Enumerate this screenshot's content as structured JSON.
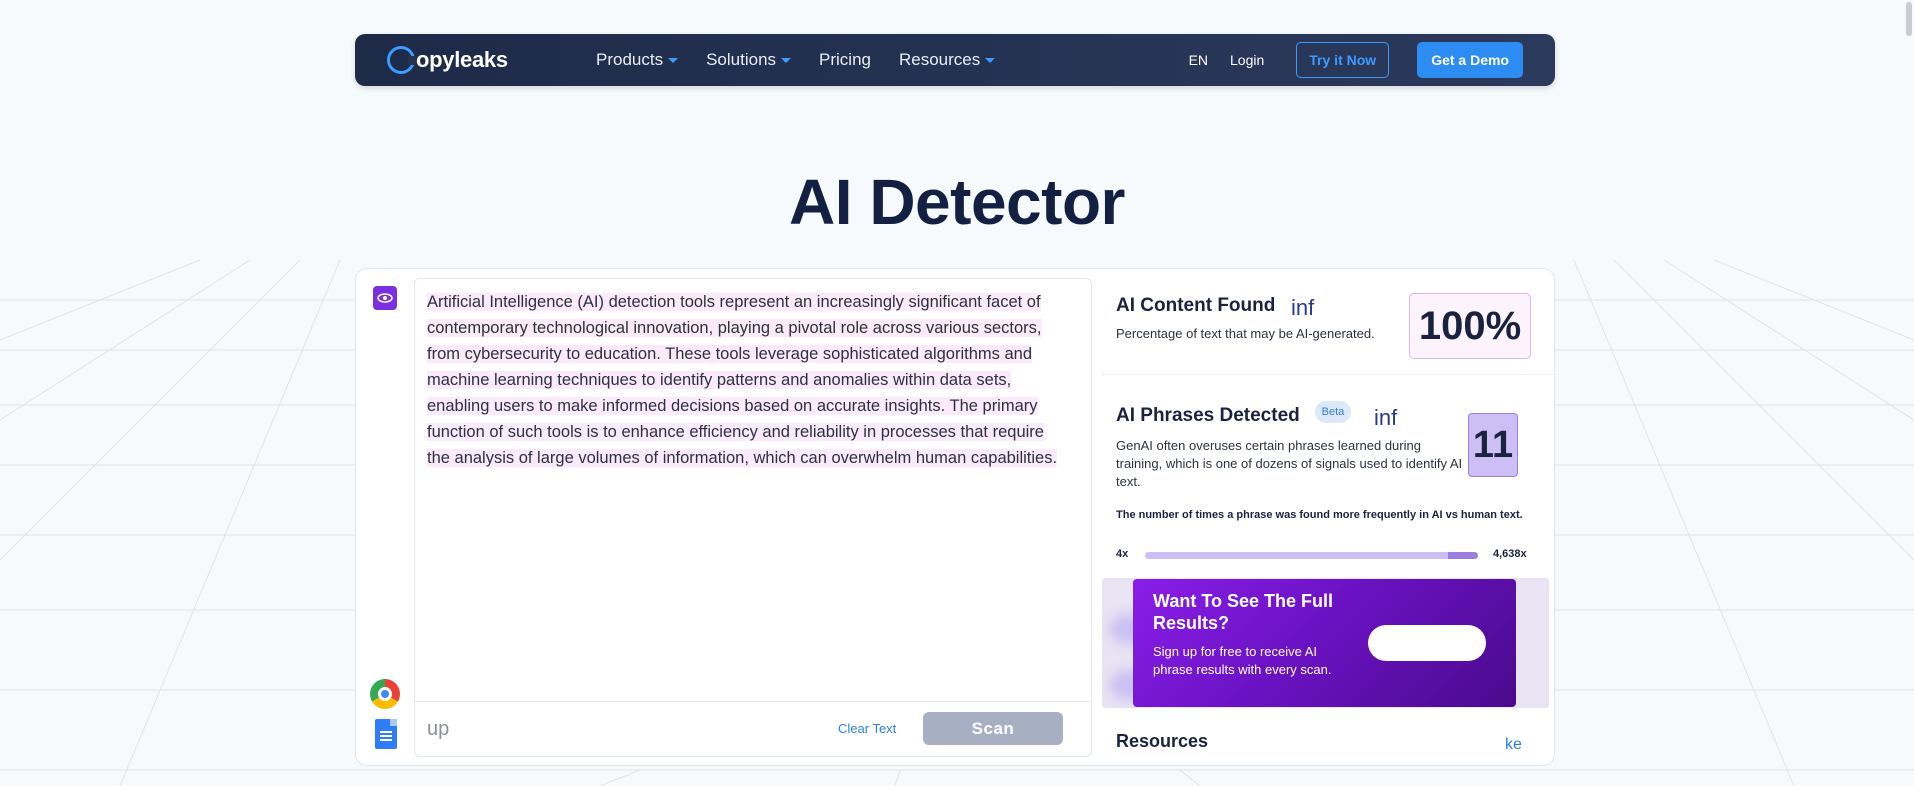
{
  "nav": {
    "brand": "Copyleaks",
    "brand_rest": "opyleaks",
    "menu": [
      {
        "label": "Products",
        "has_caret": true
      },
      {
        "label": "Solutions",
        "has_caret": true
      },
      {
        "label": "Pricing",
        "has_caret": false
      },
      {
        "label": "Resources",
        "has_caret": true
      }
    ],
    "lang": "EN",
    "login": "Login",
    "try_label": "Try it Now",
    "demo_label": "Get a Demo"
  },
  "page": {
    "title": "AI Detector"
  },
  "editor": {
    "text": "Artificial Intelligence (AI) detection tools represent an increasingly significant facet of contemporary technological innovation, playing a pivotal role across various sectors, from cybersecurity to education. These tools leverage sophisticated algorithms and machine learning techniques to identify patterns and anomalies within data sets, enabling users to make informed decisions based on accurate insights. The primary function of such tools is to enhance efficiency and reliability in processes that require the analysis of large volumes of information, which can overwhelm human capabilities.",
    "footer_left": "up",
    "clear_label": "Clear Text",
    "scan_label": "Scan"
  },
  "results": {
    "ai_content": {
      "title": "AI Content Found",
      "info": "inf",
      "subtitle": "Percentage of text that may be AI-generated.",
      "value": "100%"
    },
    "ai_phrases": {
      "title": "AI Phrases Detected",
      "badge": "Beta",
      "info": "inf",
      "description": "GenAI often overuses certain phrases learned during training, which is one of dozens of signals used to identify AI text.",
      "count": "11",
      "freq_note": "The number of times a phrase was found more frequently in AI vs human text.",
      "range_min": "4x",
      "range_max": "4,638x",
      "range_highlight_fraction": 0.09
    },
    "promo": {
      "title": "Want To See The Full Results?",
      "subtitle": "Sign up for free to receive AI phrase results with every scan."
    },
    "resources": {
      "title": "Resources",
      "link": "ke"
    }
  },
  "colors": {
    "nav_bg": "#1d2a48",
    "accent_blue": "#2d8cf2",
    "accent_purple": "#7b2fe0",
    "highlight_pink": "#fbeafb"
  },
  "icons": [
    "eye-icon",
    "chrome-icon",
    "google-docs-icon",
    "chevron-down-icon"
  ]
}
